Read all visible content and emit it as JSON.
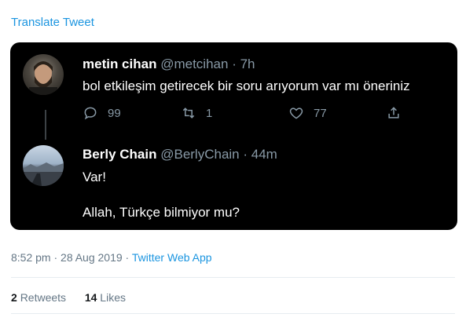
{
  "translate_label": "Translate Tweet",
  "quoted": {
    "author1": {
      "name": "metin cihan",
      "handle": "@metcihan",
      "time": "· 7h",
      "text": "bol etkileşim getirecek bir soru arıyorum var mı öneriniz",
      "replies": "99",
      "retweets": "1",
      "likes": "77"
    },
    "author2": {
      "name": "Berly Chain",
      "handle": "@BerlyChain",
      "time": "· 44m",
      "line1": "Var!",
      "line2": "Allah, Türkçe bilmiyor mu?"
    }
  },
  "meta": {
    "timestamp": "8:52 pm · 28 Aug 2019 ·",
    "app": "Twitter Web App"
  },
  "stats": {
    "retweets_count": "2",
    "retweets_label": "Retweets",
    "likes_count": "14",
    "likes_label": "Likes"
  },
  "colors": {
    "link": "#1b95e0",
    "card_bg": "#000000",
    "muted": "#8899a6"
  }
}
